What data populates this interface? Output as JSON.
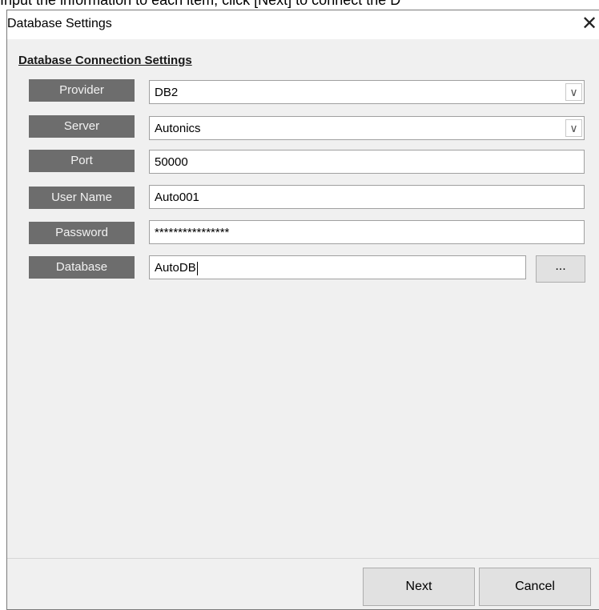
{
  "instruction_text": "Input the information to each item, click [Next] to connect the D",
  "dialog": {
    "title": "Database Settings",
    "close_glyph": "✕",
    "section_title": "Database Connection Settings",
    "fields": {
      "provider": {
        "label": "Provider",
        "value": "DB2"
      },
      "server": {
        "label": "Server",
        "value": "Autonics"
      },
      "port": {
        "label": "Port",
        "value": "50000"
      },
      "user_name": {
        "label": "User Name",
        "value": "Auto001"
      },
      "password": {
        "label": "Password",
        "value": "****************"
      },
      "database": {
        "label": "Database",
        "value": "AutoDB"
      }
    },
    "dropdown_glyph": "∨",
    "browse_label": "...",
    "buttons": {
      "next": "Next",
      "cancel": "Cancel"
    }
  }
}
